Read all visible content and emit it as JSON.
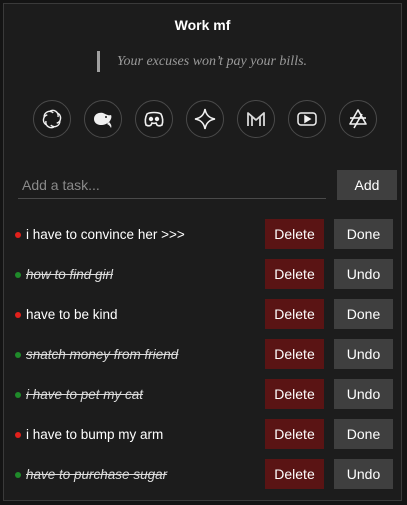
{
  "app": {
    "title": "Work mf"
  },
  "quote": {
    "text": "Your excuses won’t pay your bills."
  },
  "shortcuts": [
    {
      "name": "chatgpt-icon"
    },
    {
      "name": "deepseek-icon"
    },
    {
      "name": "discord-icon"
    },
    {
      "name": "gemini-icon"
    },
    {
      "name": "gmail-icon"
    },
    {
      "name": "youtube-icon"
    },
    {
      "name": "grok-icon"
    }
  ],
  "input": {
    "placeholder": "Add a task...",
    "value": ""
  },
  "add_label": "Add",
  "tasks": [
    {
      "text": "i have to convince her >>>",
      "done": false,
      "delete_label": "Delete",
      "action_label": "Done"
    },
    {
      "text": "how to find girl",
      "done": true,
      "delete_label": "Delete",
      "action_label": "Undo"
    },
    {
      "text": "have to be kind",
      "done": false,
      "delete_label": "Delete",
      "action_label": "Done"
    },
    {
      "text": "snatch money from friend",
      "done": true,
      "delete_label": "Delete",
      "action_label": "Undo"
    },
    {
      "text": "i have to pet my cat",
      "done": true,
      "delete_label": "Delete",
      "action_label": "Undo"
    },
    {
      "text": "i have to bump my arm",
      "done": false,
      "delete_label": "Delete",
      "action_label": "Done"
    },
    {
      "text": "have to purchase sugar",
      "done": true,
      "delete_label": "Delete",
      "action_label": "Undo"
    }
  ],
  "colors": {
    "pending_dot": "#e0201b",
    "done_dot": "#1f8a2a",
    "delete_button": "#5a1414",
    "neutral_button": "#3f3f3f"
  }
}
